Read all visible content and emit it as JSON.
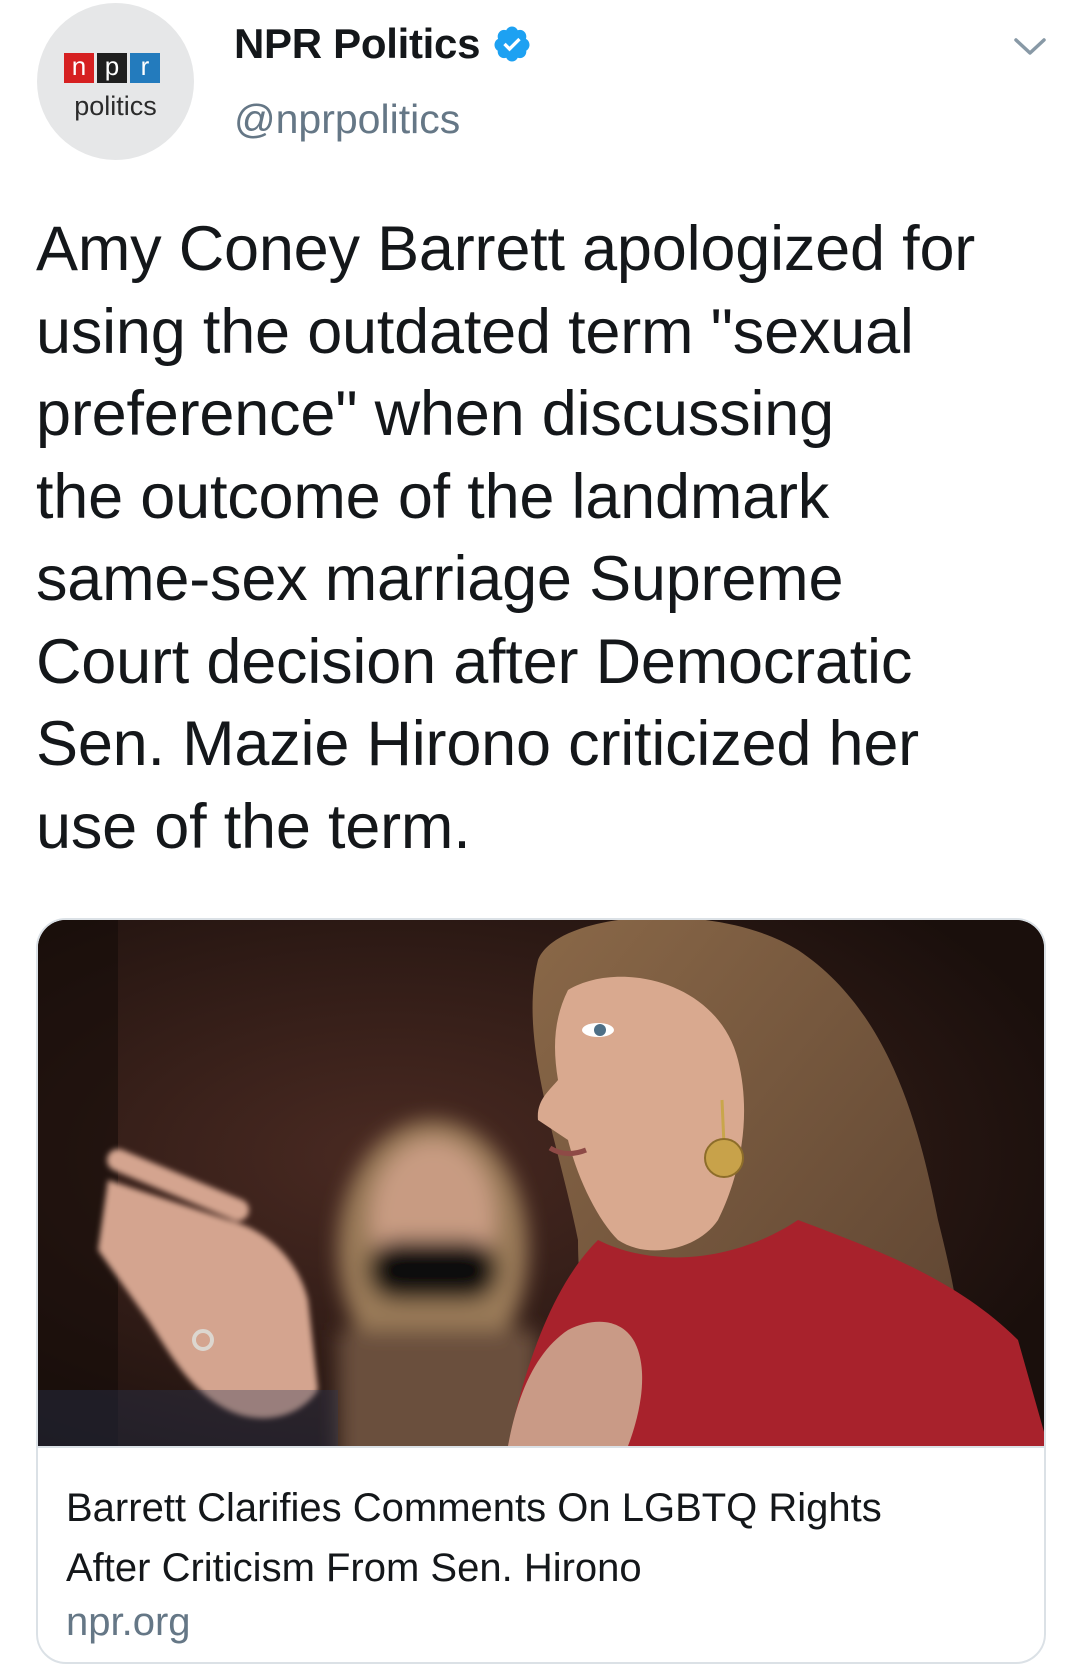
{
  "account": {
    "avatar_logo_letters": [
      "n",
      "p",
      "r"
    ],
    "avatar_subtitle": "politics",
    "display_name": "NPR Politics",
    "handle": "@nprpolitics",
    "verified": true
  },
  "tweet": {
    "text": "Amy Coney Barrett apologized for\nusing the outdated term \"sexual\npreference\" when discussing\nthe outcome of the landmark\nsame-sex marriage Supreme\nCourt decision after Democratic\nSen. Mazie Hirono criticized her\nuse of the term."
  },
  "card": {
    "title": "Barrett Clarifies Comments On LGBTQ Rights\nAfter Criticism From Sen. Hirono",
    "domain": "npr.org",
    "image_subject": "photo-of-speaker-gesturing"
  },
  "icons": {
    "verified": "verified-badge-icon",
    "menu": "chevron-down-icon"
  },
  "colors": {
    "verified_blue": "#1da1f2",
    "secondary_text": "#657786",
    "npr_red": "#d62021",
    "npr_black": "#1f1f1f",
    "npr_blue": "#237bbd"
  }
}
